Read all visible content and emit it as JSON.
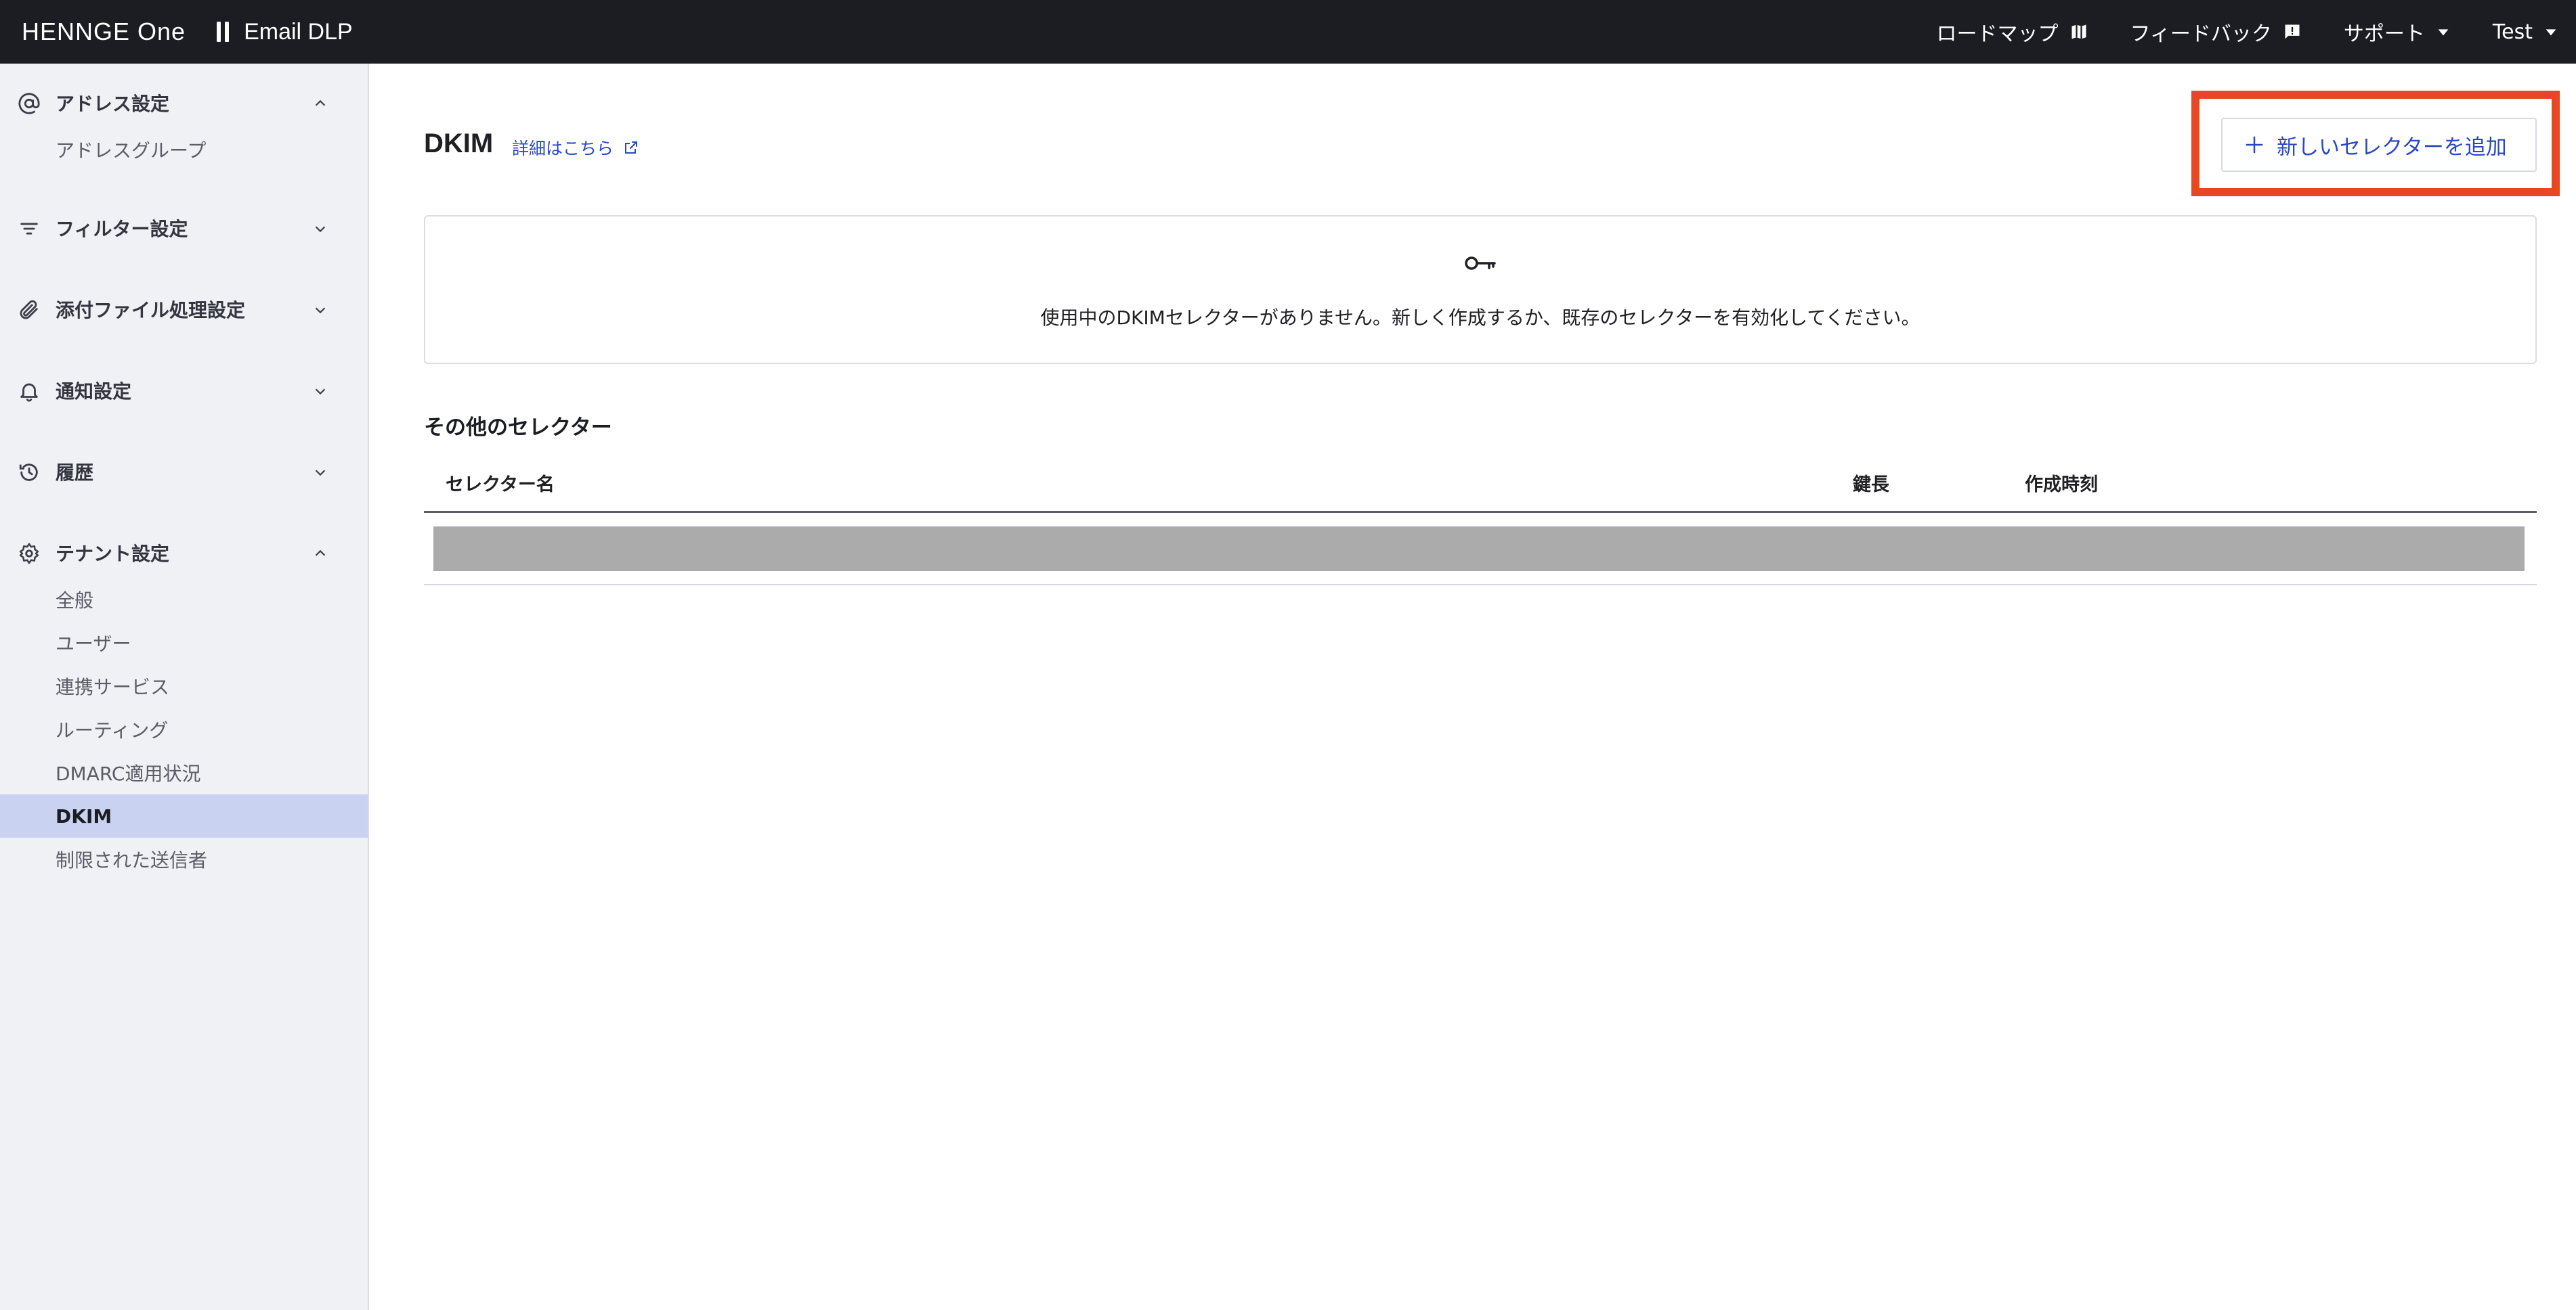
{
  "topbar": {
    "brand": "HENNGE One",
    "product": "Email DLP",
    "nav": [
      {
        "label": "ロードマップ",
        "icon": "map-icon"
      },
      {
        "label": "フィードバック",
        "icon": "feedback-icon"
      },
      {
        "label": "サポート",
        "icon": "caret-down-icon"
      },
      {
        "label": "Test",
        "icon": "caret-down-icon"
      }
    ]
  },
  "sidebar": {
    "sections": [
      {
        "label": "アドレス設定",
        "icon": "at-sign-icon",
        "expanded": true,
        "items": [
          "アドレスグループ"
        ]
      },
      {
        "label": "フィルター設定",
        "icon": "filter-icon",
        "expanded": false
      },
      {
        "label": "添付ファイル処理設定",
        "icon": "paperclip-icon",
        "expanded": false
      },
      {
        "label": "通知設定",
        "icon": "bell-icon",
        "expanded": false
      },
      {
        "label": "履歴",
        "icon": "history-icon",
        "expanded": false
      },
      {
        "label": "テナント設定",
        "icon": "gear-icon",
        "expanded": true,
        "items": [
          "全般",
          "ユーザー",
          "連携サービス",
          "ルーティング",
          "DMARC適用状況",
          "DKIM",
          "制限された送信者"
        ]
      }
    ],
    "active_item": "DKIM"
  },
  "main": {
    "title": "DKIM",
    "detail_link": "詳細はこちら",
    "add_button": "新しいセレクターを追加",
    "empty_message": "使用中のDKIMセレクターがありません。新しく作成するか、既存のセレクターを有効化してください。",
    "other_title": "その他のセレクター",
    "columns": [
      "セレクター名",
      "鍵長",
      "作成時刻"
    ]
  },
  "colors": {
    "topbar_bg": "#1c1d22",
    "sidebar_bg": "#f0f1f5",
    "active_bg": "#c9d3f1",
    "link": "#2848c8",
    "highlight": "#e84723"
  }
}
